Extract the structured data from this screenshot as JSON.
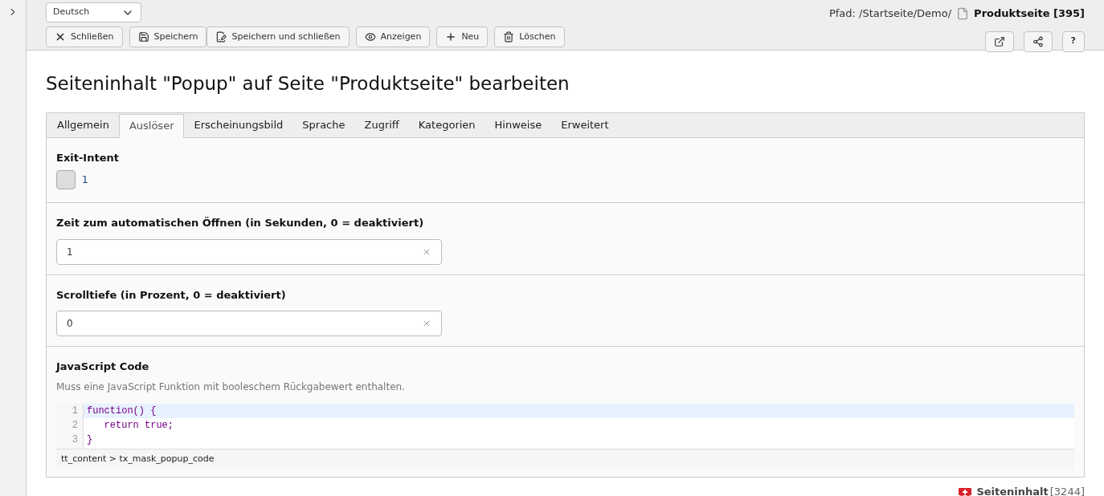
{
  "language_select": {
    "value": "Deutsch"
  },
  "toolbar": [
    {
      "kind": "close",
      "label": "Schließen"
    },
    {
      "kind": "save",
      "label": "Speichern"
    },
    {
      "kind": "saveclose",
      "label": "Speichern und schließen"
    },
    {
      "kind": "view",
      "label": "Anzeigen"
    },
    {
      "kind": "new",
      "label": "Neu"
    },
    {
      "kind": "delete",
      "label": "Löschen"
    }
  ],
  "help_button": {
    "label": "?"
  },
  "path": {
    "label": "Pfad: /Startseite/Demo/",
    "page": "Produktseite [395]"
  },
  "heading": "Seiteninhalt \"Popup\" auf Seite \"Produktseite\" bearbeiten",
  "tabs": [
    {
      "label": "Allgemein",
      "selected": false
    },
    {
      "label": "Auslöser",
      "selected": true
    },
    {
      "label": "Erscheinungsbild",
      "selected": false
    },
    {
      "label": "Sprache",
      "selected": false
    },
    {
      "label": "Zugriff",
      "selected": false
    },
    {
      "label": "Kategorien",
      "selected": false
    },
    {
      "label": "Hinweise",
      "selected": false
    },
    {
      "label": "Erweitert",
      "selected": false
    }
  ],
  "sections": [
    {
      "kind": "checkbox",
      "label": "Exit-Intent",
      "checked": false,
      "option": "1"
    },
    {
      "kind": "input",
      "label": "Zeit zum automatischen Öffnen (in Sekunden, 0 = deaktiviert)",
      "value": "1"
    },
    {
      "kind": "input",
      "label": "Scrolltiefe (in Prozent, 0 = deaktiviert)",
      "value": "0"
    },
    {
      "kind": "code",
      "label": "JavaScript Code",
      "description": "Muss eine JavaScript Funktion mit booleschem Rückgabewert enthalten.",
      "lines": [
        {
          "number": "1",
          "text": "function() {",
          "highlighted": true
        },
        {
          "number": "2",
          "text": "   return true;",
          "highlighted": false
        },
        {
          "number": "3",
          "text": "}",
          "highlighted": false
        }
      ],
      "footer": "tt_content > tx_mask_popup_code"
    }
  ],
  "record": {
    "type": "Seiteninhalt",
    "id": "[3244]"
  }
}
